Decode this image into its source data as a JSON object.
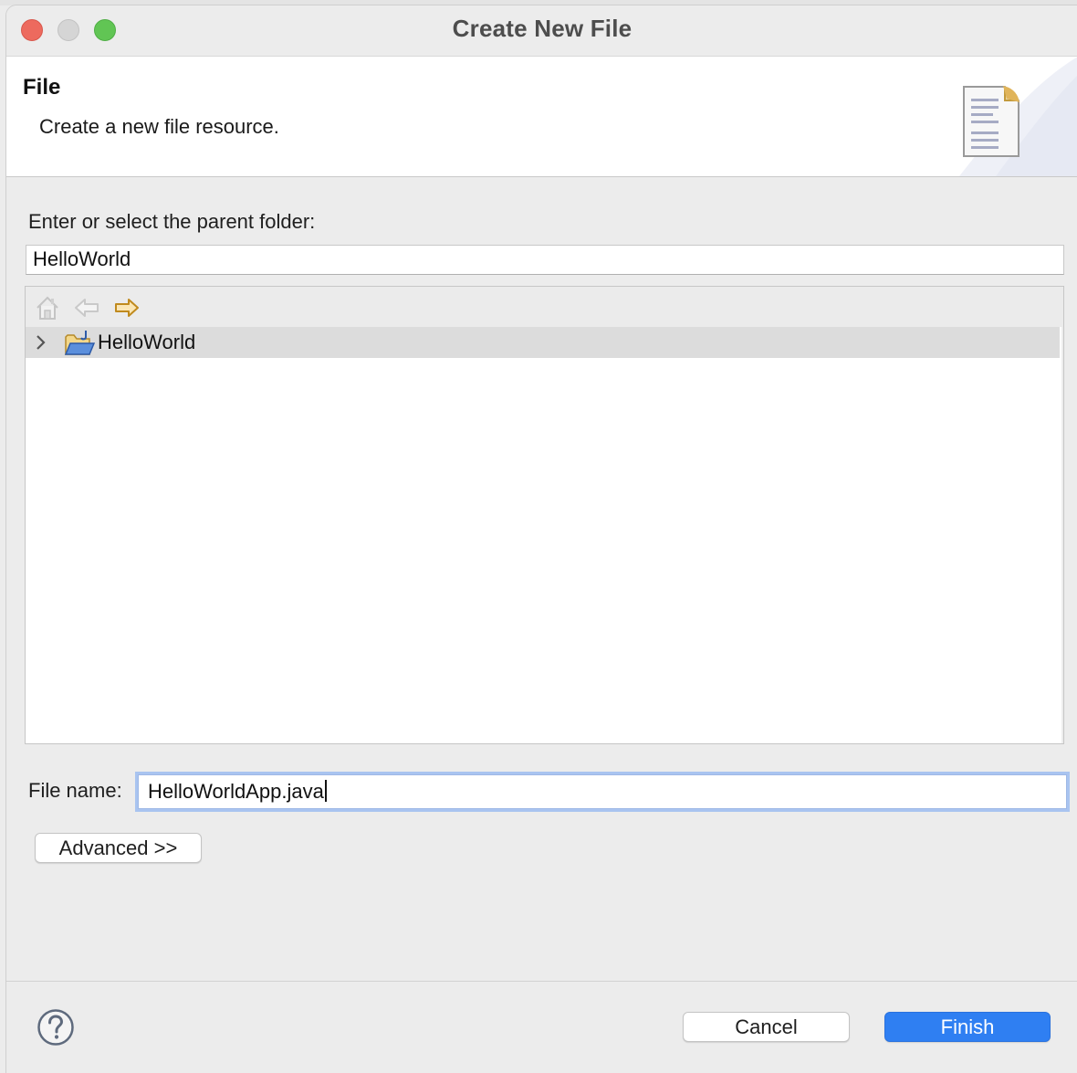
{
  "window": {
    "title": "Create New File"
  },
  "banner": {
    "title": "File",
    "description": "Create a new file resource.",
    "icon": "new-file-document-icon"
  },
  "parent_folder": {
    "label": "Enter or select the parent folder:",
    "value": "HelloWorld"
  },
  "tree": {
    "toolbar": [
      {
        "name": "home-icon",
        "enabled": false
      },
      {
        "name": "back-arrow-icon",
        "enabled": false
      },
      {
        "name": "forward-arrow-icon",
        "enabled": true
      }
    ],
    "items": [
      {
        "label": "HelloWorld",
        "icon": "java-project-folder-icon",
        "expanded": false,
        "selected": true
      }
    ]
  },
  "file_name": {
    "label": "File name:",
    "value": "HelloWorldApp.java"
  },
  "buttons": {
    "advanced": "Advanced >>",
    "cancel": "Cancel",
    "finish": "Finish"
  },
  "footer": {
    "help_icon": "question-mark-help-icon"
  },
  "colors": {
    "primary_button": "#2f7ff2",
    "focus_ring": "#a9c4f0",
    "close": "#ed6a5e",
    "maximize": "#61c554"
  }
}
